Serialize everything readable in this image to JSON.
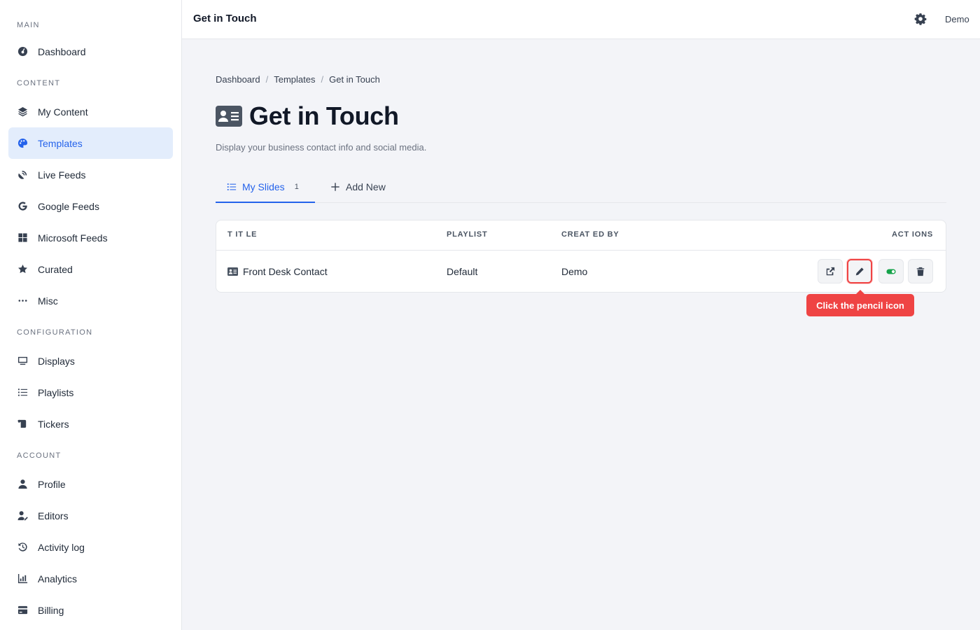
{
  "sidebar": {
    "sections": {
      "main": "MAIN",
      "content": "CONTENT",
      "configuration": "CONFIGURATION",
      "account": "ACCOUNT"
    },
    "items": {
      "dashboard": {
        "label": "Dashboard",
        "icon": "gauge-icon"
      },
      "my_content": {
        "label": "My Content",
        "icon": "layers-icon"
      },
      "templates": {
        "label": "Templates",
        "icon": "palette-icon",
        "active": true
      },
      "live_feeds": {
        "label": "Live Feeds",
        "icon": "satellite-dish-icon"
      },
      "google_feeds": {
        "label": "Google Feeds",
        "icon": "google-icon"
      },
      "microsoft_feeds": {
        "label": "Microsoft Feeds",
        "icon": "windows-icon"
      },
      "curated": {
        "label": "Curated",
        "icon": "star-icon"
      },
      "misc": {
        "label": "Misc",
        "icon": "ellipsis-icon"
      },
      "displays": {
        "label": "Displays",
        "icon": "monitor-icon"
      },
      "playlists": {
        "label": "Playlists",
        "icon": "list-icon"
      },
      "tickers": {
        "label": "Tickers",
        "icon": "scroll-icon"
      },
      "profile": {
        "label": "Profile",
        "icon": "user-icon"
      },
      "editors": {
        "label": "Editors",
        "icon": "user-pen-icon"
      },
      "activity_log": {
        "label": "Activity log",
        "icon": "history-icon"
      },
      "analytics": {
        "label": "Analytics",
        "icon": "chart-icon"
      },
      "billing": {
        "label": "Billing",
        "icon": "credit-card-icon"
      }
    }
  },
  "header": {
    "title": "Get in Touch",
    "user": "Demo"
  },
  "breadcrumb": [
    "Dashboard",
    "Templates",
    "Get in Touch"
  ],
  "page": {
    "title": "Get in Touch",
    "subtitle": "Display your business contact info and social media."
  },
  "tabs": {
    "my_slides": {
      "label": "My Slides",
      "count": "1"
    },
    "add_new": {
      "label": "Add New"
    }
  },
  "table": {
    "headers": {
      "title": "T IT LE",
      "playlist": "PLAYLIST",
      "created_by": "CREAT ED BY",
      "actions": "ACT IONS"
    },
    "rows": [
      {
        "title": "Front Desk Contact",
        "playlist": "Default",
        "created_by": "Demo"
      }
    ]
  },
  "tooltip": "Click the pencil icon",
  "colors": {
    "accent": "#2563eb",
    "active_bg": "#e3edfc",
    "highlight": "#ef4444",
    "toggle_on": "#16a34a"
  }
}
